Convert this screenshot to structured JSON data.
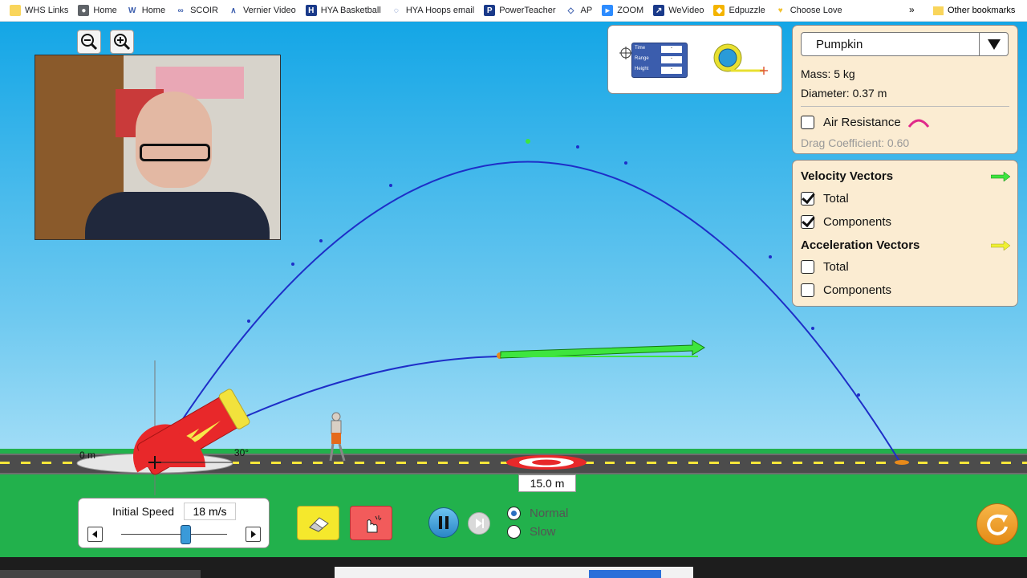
{
  "bookmarks": [
    {
      "label": "WHS Links",
      "icon": "folder-icon"
    },
    {
      "label": "Home",
      "icon": "globe-icon"
    },
    {
      "label": "Home",
      "icon": "w-logo-icon"
    },
    {
      "label": "SCOIR",
      "icon": "scoir-icon"
    },
    {
      "label": "Vernier Video",
      "icon": "vernier-icon"
    },
    {
      "label": "HYA Basketball",
      "icon": "hya-icon"
    },
    {
      "label": "HYA Hoops email",
      "icon": "hoops-icon"
    },
    {
      "label": "PowerTeacher",
      "icon": "powerteacher-icon"
    },
    {
      "label": "AP",
      "icon": "ap-icon"
    },
    {
      "label": "ZOOM",
      "icon": "zoom-icon"
    },
    {
      "label": "WeVideo",
      "icon": "wevideo-icon"
    },
    {
      "label": "Edpuzzle",
      "icon": "edpuzzle-icon"
    },
    {
      "label": "Choose Love",
      "icon": "heart-icon"
    }
  ],
  "bookmarks_overflow": "»",
  "other_bookmarks": "Other bookmarks",
  "measure_tool": {
    "rows": [
      "Time",
      "Range",
      "Height"
    ],
    "value": "-"
  },
  "projectile": {
    "selected": "Pumpkin",
    "mass": "Mass: 5 kg",
    "diameter": "Diameter: 0.37 m",
    "air_resistance": "Air Resistance",
    "drag": "Drag Coefficient: 0.60"
  },
  "vectors": {
    "velocity_title": "Velocity Vectors",
    "acceleration_title": "Acceleration Vectors",
    "total": "Total",
    "components": "Components",
    "velocity_total_checked": true,
    "velocity_components_checked": true,
    "accel_total_checked": false,
    "accel_components_checked": false
  },
  "cannon": {
    "height_label": "0 m",
    "angle_label": "30°"
  },
  "target_distance": "15.0 m",
  "speed": {
    "label": "Initial Speed",
    "value": "18 m/s",
    "slider_fraction": 0.6
  },
  "time_speed": {
    "normal": "Normal",
    "slow": "Slow",
    "selected": "Normal"
  },
  "colors": {
    "trajectory": "#1e2ec8",
    "velocity": "#3ee53e",
    "acceleration": "#f0f032",
    "cannon": "#e8282a",
    "panel": "#fbecd2"
  }
}
